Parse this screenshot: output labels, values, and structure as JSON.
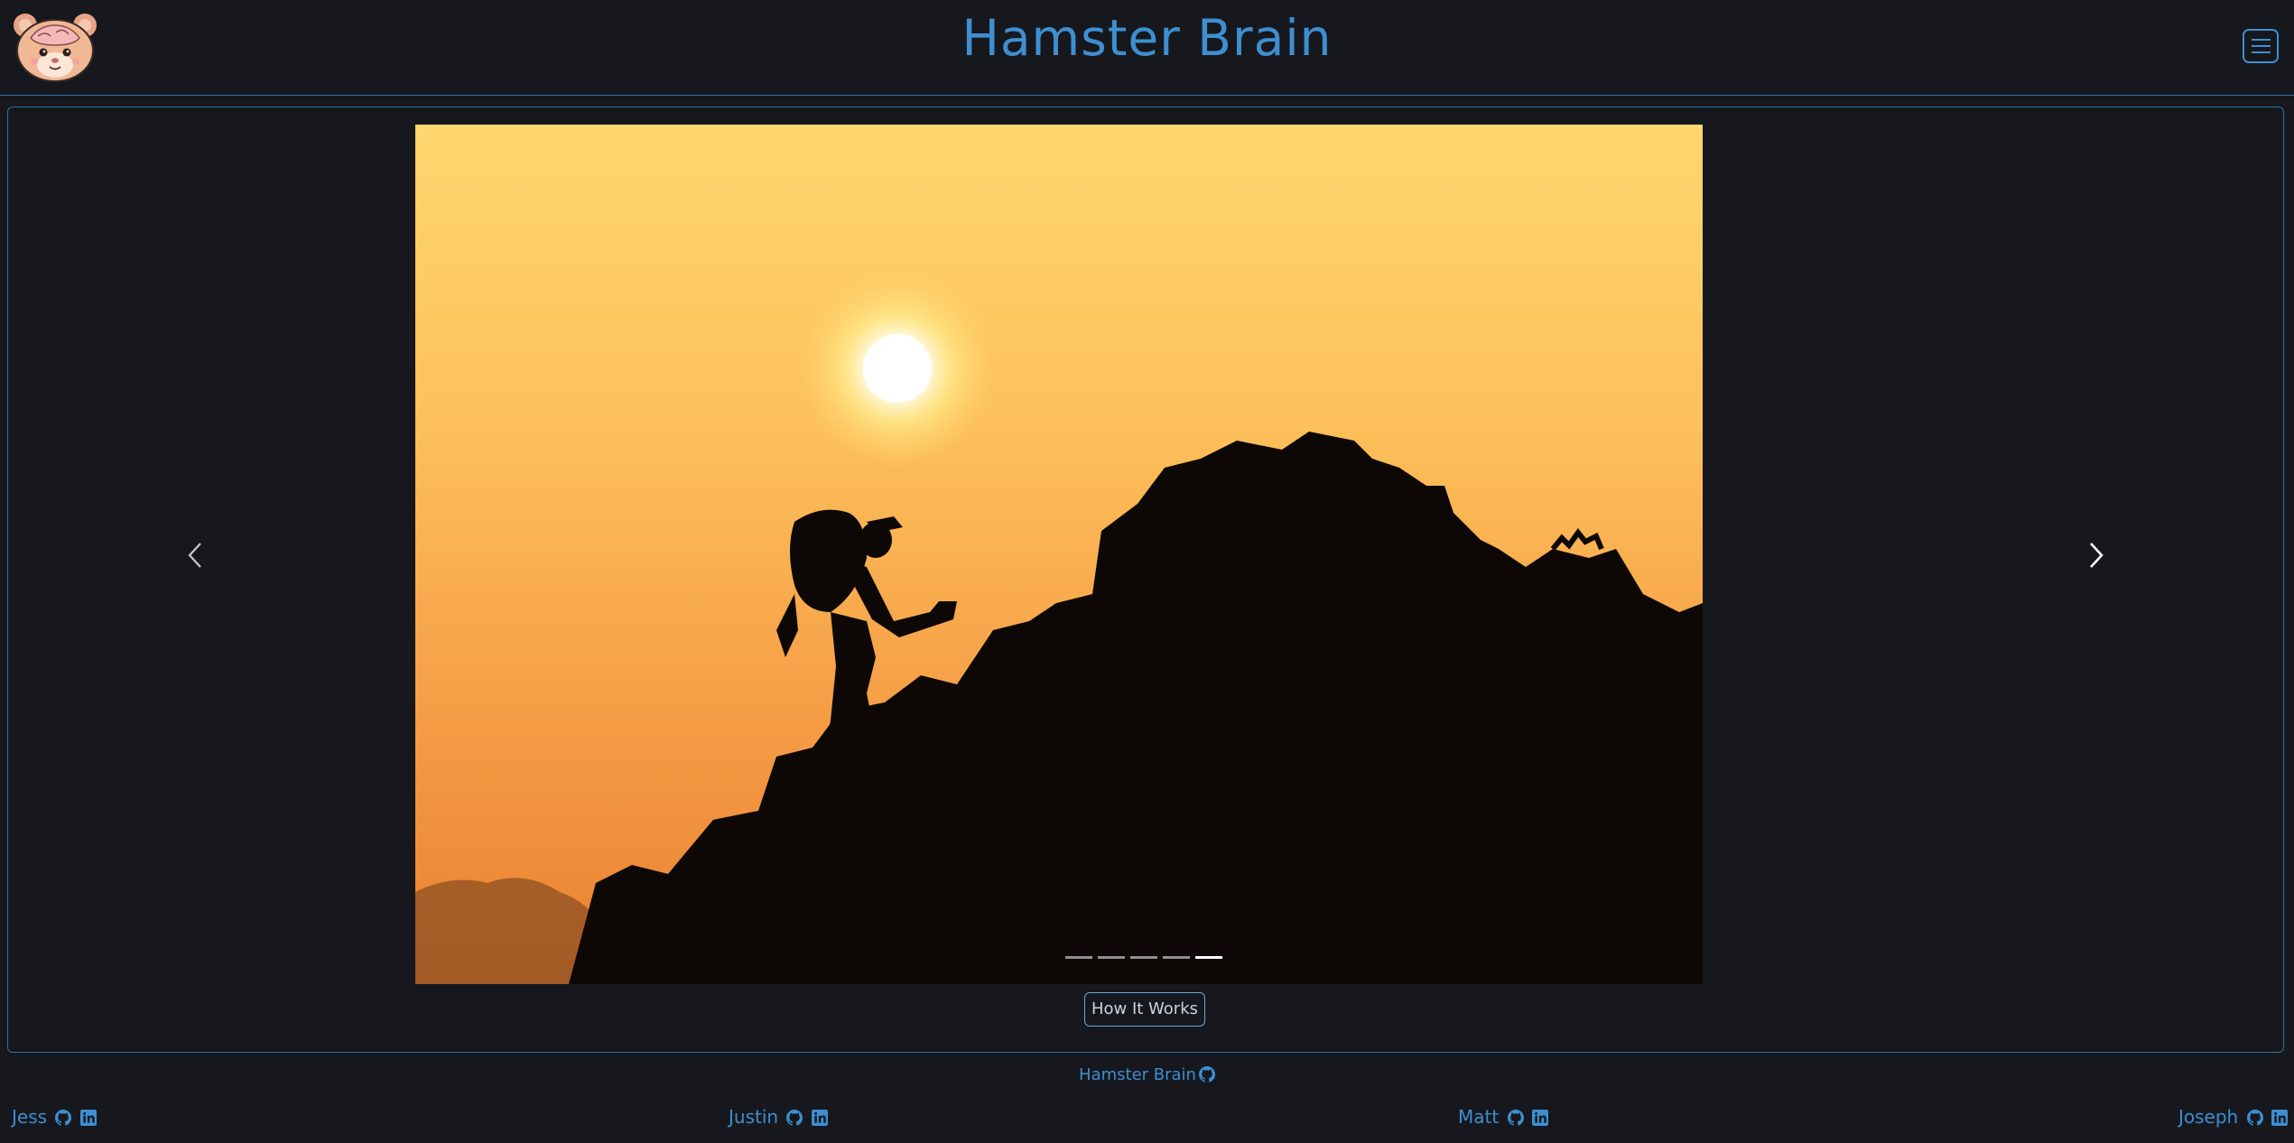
{
  "header": {
    "title": "Hamster Brain",
    "logo_icon": "hamster-logo-icon",
    "menu_icon": "hamburger-menu-icon"
  },
  "carousel": {
    "image_description_icon": "hiker-silhouette-sunset-image",
    "prev_icon": "chevron-left-icon",
    "next_icon": "chevron-right-icon",
    "slide_count": 5,
    "active_slide": 5
  },
  "cta": {
    "how_it_works_label": "How It Works"
  },
  "footer": {
    "repo_label": "Hamster Brain",
    "contributors": [
      {
        "name": "Jess"
      },
      {
        "name": "Justin"
      },
      {
        "name": "Matt"
      },
      {
        "name": "Joseph"
      }
    ]
  },
  "colors": {
    "background": "#16181d",
    "accent": "#3d8fd1",
    "border": "#2f6fa3"
  }
}
